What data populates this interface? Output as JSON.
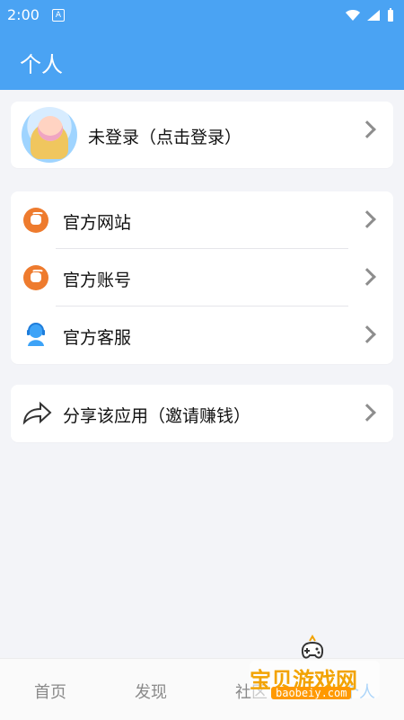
{
  "status_bar": {
    "time": "2:00",
    "a_icon": "A",
    "icons": [
      "wifi-icon",
      "signal-icon",
      "battery-icon"
    ]
  },
  "header": {
    "title": "个人"
  },
  "profile": {
    "label": "未登录（点击登录）"
  },
  "official": {
    "items": [
      {
        "label": "官方网站",
        "icon": "mask-icon"
      },
      {
        "label": "官方账号",
        "icon": "mask-icon"
      },
      {
        "label": "官方客服",
        "icon": "customer-service-icon"
      }
    ]
  },
  "share": {
    "label": "分享该应用（邀请赚钱）",
    "icon": "share-arrow-icon"
  },
  "bottom_nav": {
    "tabs": [
      {
        "label": "首页"
      },
      {
        "label": "发现"
      },
      {
        "label": "社区"
      },
      {
        "label": "个人"
      }
    ]
  },
  "watermark": {
    "text": "宝贝游戏网",
    "domain": "baobeiy.com"
  },
  "colors": {
    "primary": "#4aa3f3",
    "orange": "#ee7b2e"
  }
}
